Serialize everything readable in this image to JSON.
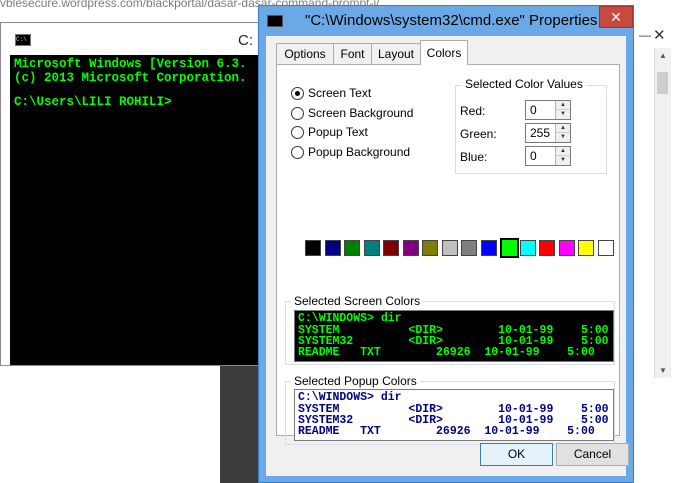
{
  "url_fragment": "vblesecure.wordpress.com/blackportal/dasar-dasar-command-prompt-i/",
  "console": {
    "title_fragment": "C:",
    "lines": [
      "Microsoft Windows [Version 6.3.",
      "(c) 2013 Microsoft Corporation.",
      "",
      "C:\\Users\\LILI ROHILI>"
    ]
  },
  "background_window": {
    "minimize": "—",
    "close": "✕"
  },
  "dialog": {
    "title": "\"C:\\Windows\\system32\\cmd.exe\" Properties",
    "close": "✕",
    "tabs": [
      {
        "label": "Options",
        "active": false
      },
      {
        "label": "Font",
        "active": false
      },
      {
        "label": "Layout",
        "active": false
      },
      {
        "label": "Colors",
        "active": true
      }
    ],
    "radio_options": [
      {
        "label": "Screen Text",
        "checked": true
      },
      {
        "label": "Screen Background",
        "checked": false
      },
      {
        "label": "Popup Text",
        "checked": false
      },
      {
        "label": "Popup Background",
        "checked": false
      }
    ],
    "color_values": {
      "caption": "Selected Color Values",
      "red_label": "Red:",
      "red": "0",
      "green_label": "Green:",
      "green": "255",
      "blue_label": "Blue:",
      "blue": "0"
    },
    "palette": [
      "#000000",
      "#000080",
      "#008000",
      "#008080",
      "#800000",
      "#800080",
      "#808000",
      "#c0c0c0",
      "#808080",
      "#0000ff",
      "#00ff00",
      "#00ffff",
      "#ff0000",
      "#ff00ff",
      "#ffff00",
      "#ffffff"
    ],
    "palette_selected_index": 10,
    "screen_colors": {
      "caption": "Selected Screen Colors",
      "text_color": "#00ff00",
      "bg_color": "#000000",
      "lines": [
        "C:\\WINDOWS> dir",
        "SYSTEM          <DIR>        10-01-99    5:00",
        "SYSTEM32        <DIR>        10-01-99    5:00",
        "README   TXT        26926  10-01-99    5:00"
      ]
    },
    "popup_colors": {
      "caption": "Selected Popup Colors",
      "text_color": "#000080",
      "bg_color": "#ffffff",
      "lines": [
        "C:\\WINDOWS> dir",
        "SYSTEM          <DIR>        10-01-99    5:00",
        "SYSTEM32        <DIR>        10-01-99    5:00",
        "README   TXT        26926  10-01-99    5:00"
      ]
    },
    "ok_label": "OK",
    "cancel_label": "Cancel"
  }
}
